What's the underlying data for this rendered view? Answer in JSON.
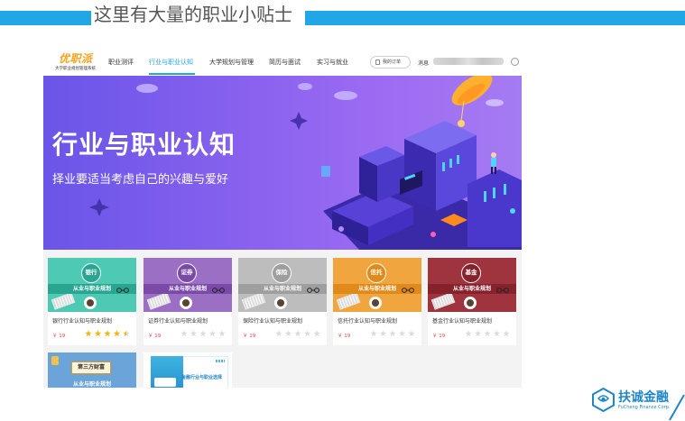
{
  "slide": {
    "title": "这里有大量的职业小贴士",
    "accent_color": "#21a7e6"
  },
  "nav": {
    "logo_text": "优职派",
    "logo_subtitle": "大学职业规划管理系统",
    "items": [
      {
        "label": "职业测评",
        "active": false
      },
      {
        "label": "行业与职业认知",
        "active": true
      },
      {
        "label": "大学规划与管理",
        "active": false
      },
      {
        "label": "简历与面试",
        "active": false
      },
      {
        "label": "实习与就业",
        "active": false
      }
    ],
    "order_button": "我的订单",
    "message_label": "消息",
    "user_icon": "user-circle-icon"
  },
  "banner": {
    "title": "行业与职业认知",
    "subtitle": "择业要适当考虑自己的兴趣与爱好"
  },
  "cards": [
    {
      "badge": "银行",
      "banner_text": "从业与职业规划",
      "name": "银行行业认知与职业规划",
      "price": "￥ 19",
      "rating": 4.5,
      "color": "#4ec9b4",
      "band": "#2aa591"
    },
    {
      "badge": "证券",
      "banner_text": "从业与职业规划",
      "name": "证券行业认知与职业规划",
      "price": "￥ 19",
      "rating": 0,
      "color": "#9a6fc4",
      "band": "#7b4aa8"
    },
    {
      "badge": "保险",
      "banner_text": "从业与职业规划",
      "name": "保险行业认知与职业规划",
      "price": "￥ 19",
      "rating": 0,
      "color": "#bdbdbd",
      "band": "#9e9e9e"
    },
    {
      "badge": "信托",
      "banner_text": "从业与职业规划",
      "name": "信托行业认知与职业规划",
      "price": "￥ 19",
      "rating": 0,
      "color": "#f0a53e",
      "band": "#e08a1c"
    },
    {
      "badge": "基金",
      "banner_text": "从业与职业规划",
      "name": "基金行业认知与职业规划",
      "price": "￥ 19",
      "rating": 0,
      "color": "#a0343e",
      "band": "#85222c"
    }
  ],
  "cards_row2": [
    {
      "badge": "第三方财富",
      "banner_text": "从业与职业规划",
      "color": "#6aa4d8"
    },
    {
      "banner_text": "金融行业与职业选择",
      "color": "#ffffff"
    }
  ],
  "footer": {
    "company_name": "扶诚金融",
    "company_en": "FuCheng Finance Corp."
  }
}
